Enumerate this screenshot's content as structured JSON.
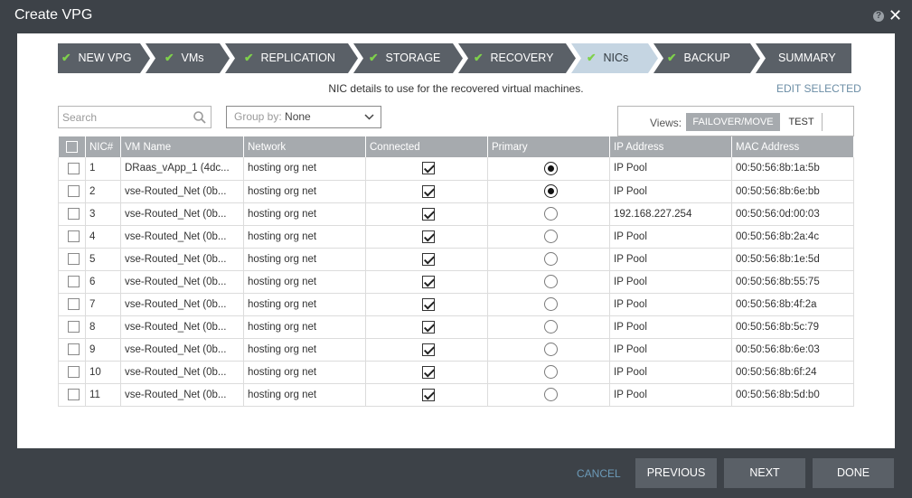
{
  "dialog": {
    "title": "Create VPG",
    "help_icon": "?",
    "close_icon": "✕"
  },
  "wizard": {
    "steps": [
      {
        "label": "NEW VPG",
        "completed": true,
        "active": false
      },
      {
        "label": "VMs",
        "completed": true,
        "active": false
      },
      {
        "label": "REPLICATION",
        "completed": true,
        "active": false
      },
      {
        "label": "STORAGE",
        "completed": true,
        "active": false
      },
      {
        "label": "RECOVERY",
        "completed": true,
        "active": false
      },
      {
        "label": "NICs",
        "completed": true,
        "active": true
      },
      {
        "label": "BACKUP",
        "completed": true,
        "active": false
      },
      {
        "label": "SUMMARY",
        "completed": false,
        "active": false
      }
    ],
    "check_glyph": "✔"
  },
  "main": {
    "subtitle": "NIC details to use for the recovered virtual machines.",
    "edit_selected": "EDIT SELECTED"
  },
  "toolbar": {
    "search_placeholder": "Search",
    "group_by_label": "Group by:",
    "group_by_value": "None",
    "views_label": "Views:",
    "view_failover": "FAILOVER/MOVE",
    "view_test": "TEST"
  },
  "table": {
    "columns": [
      "NIC#",
      "VM Name",
      "Network",
      "Connected",
      "Primary",
      "IP Address",
      "MAC Address"
    ],
    "rows": [
      {
        "nic": "1",
        "vm": "DRaas_vApp_1 (4dc...",
        "network": "hosting org net",
        "connected": true,
        "primary": true,
        "ip": "IP Pool",
        "mac": "00:50:56:8b:1a:5b"
      },
      {
        "nic": "2",
        "vm": "vse-Routed_Net (0b...",
        "network": "hosting org net",
        "connected": true,
        "primary": true,
        "ip": "IP Pool",
        "mac": "00:50:56:8b:6e:bb"
      },
      {
        "nic": "3",
        "vm": "vse-Routed_Net (0b...",
        "network": "hosting org net",
        "connected": true,
        "primary": false,
        "ip": "192.168.227.254",
        "mac": "00:50:56:0d:00:03"
      },
      {
        "nic": "4",
        "vm": "vse-Routed_Net (0b...",
        "network": "hosting org net",
        "connected": true,
        "primary": false,
        "ip": "IP Pool",
        "mac": "00:50:56:8b:2a:4c"
      },
      {
        "nic": "5",
        "vm": "vse-Routed_Net (0b...",
        "network": "hosting org net",
        "connected": true,
        "primary": false,
        "ip": "IP Pool",
        "mac": "00:50:56:8b:1e:5d"
      },
      {
        "nic": "6",
        "vm": "vse-Routed_Net (0b...",
        "network": "hosting org net",
        "connected": true,
        "primary": false,
        "ip": "IP Pool",
        "mac": "00:50:56:8b:55:75"
      },
      {
        "nic": "7",
        "vm": "vse-Routed_Net (0b...",
        "network": "hosting org net",
        "connected": true,
        "primary": false,
        "ip": "IP Pool",
        "mac": "00:50:56:8b:4f:2a"
      },
      {
        "nic": "8",
        "vm": "vse-Routed_Net (0b...",
        "network": "hosting org net",
        "connected": true,
        "primary": false,
        "ip": "IP Pool",
        "mac": "00:50:56:8b:5c:79"
      },
      {
        "nic": "9",
        "vm": "vse-Routed_Net (0b...",
        "network": "hosting org net",
        "connected": true,
        "primary": false,
        "ip": "IP Pool",
        "mac": "00:50:56:8b:6e:03"
      },
      {
        "nic": "10",
        "vm": "vse-Routed_Net (0b...",
        "network": "hosting org net",
        "connected": true,
        "primary": false,
        "ip": "IP Pool",
        "mac": "00:50:56:8b:6f:24"
      },
      {
        "nic": "11",
        "vm": "vse-Routed_Net (0b...",
        "network": "hosting org net",
        "connected": true,
        "primary": false,
        "ip": "IP Pool",
        "mac": "00:50:56:8b:5d:b0"
      }
    ]
  },
  "footer": {
    "cancel": "CANCEL",
    "previous": "PREVIOUS",
    "next": "NEXT",
    "done": "DONE"
  },
  "colors": {
    "step_bg": "#5a6067",
    "step_active_bg": "#c5d5e2",
    "check": "#7fd14b",
    "header_bg": "#a6aaae",
    "link": "#6c8ea6"
  }
}
